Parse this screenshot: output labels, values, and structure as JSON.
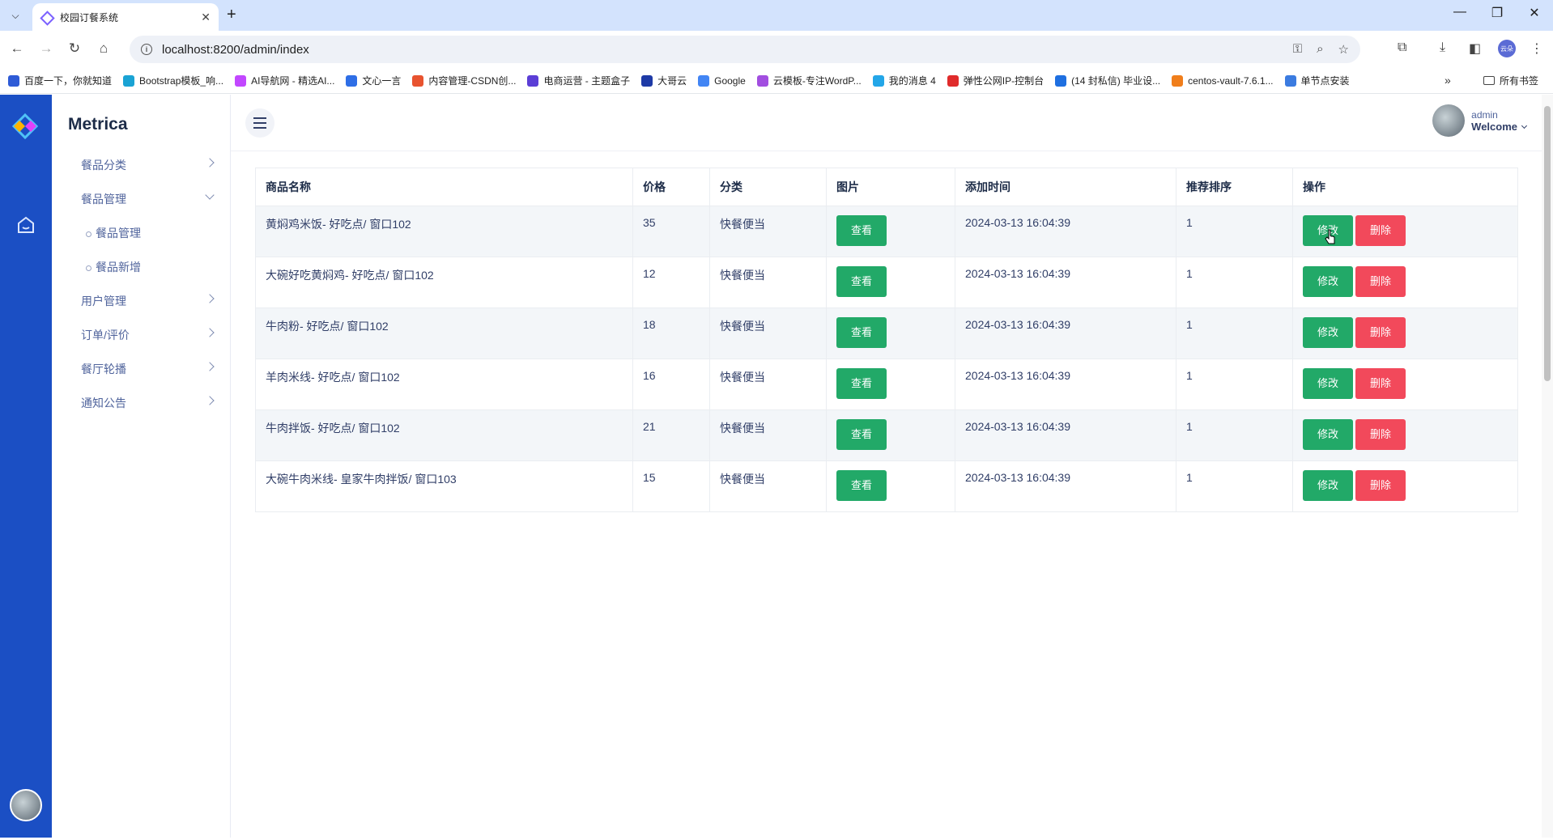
{
  "browser": {
    "tab_title": "校园订餐系统",
    "url": "localhost:8200/admin/index",
    "bookmarks": [
      {
        "label": "百度一下，你就知道",
        "color": "#2e5bd6"
      },
      {
        "label": "Bootstrap模板_响...",
        "color": "#1aa3d4"
      },
      {
        "label": "AI导航网 - 精选AI...",
        "color": "#c247ff"
      },
      {
        "label": "文心一言",
        "color": "#2e6ee6"
      },
      {
        "label": "内容管理-CSDN创...",
        "color": "#e8532f"
      },
      {
        "label": "电商运营 - 主题盒子",
        "color": "#5b3ed6"
      },
      {
        "label": "大哥云",
        "color": "#1e3aa6"
      },
      {
        "label": "Google",
        "color": "#4285f4"
      },
      {
        "label": "云模板-专注WordP...",
        "color": "#a24ee0"
      },
      {
        "label": "我的消息 4",
        "color": "#23a6e8"
      },
      {
        "label": "弹性公网IP-控制台",
        "color": "#e02b2b"
      },
      {
        "label": "(14 封私信) 毕业设...",
        "color": "#1e6fe0"
      },
      {
        "label": "centos-vault-7.6.1...",
        "color": "#f07e1b"
      },
      {
        "label": "单节点安装",
        "color": "#3b7be0"
      }
    ],
    "bookmarks_folder": "所有书签",
    "profile_initials": "云朵"
  },
  "sidebar": {
    "brand": "Metrica",
    "menu": [
      {
        "label": "餐品分类",
        "expanded": false
      },
      {
        "label": "餐品管理",
        "expanded": true,
        "children": [
          "餐品管理",
          "餐品新增"
        ]
      },
      {
        "label": "用户管理",
        "expanded": false
      },
      {
        "label": "订单/评价",
        "expanded": false
      },
      {
        "label": "餐厅轮播",
        "expanded": false
      },
      {
        "label": "通知公告",
        "expanded": false
      }
    ]
  },
  "header": {
    "user_name": "admin",
    "welcome": "Welcome"
  },
  "table": {
    "columns": [
      "商品名称",
      "价格",
      "分类",
      "图片",
      "添加时间",
      "推荐排序",
      "操作"
    ],
    "view_label": "查看",
    "edit_label": "修改",
    "delete_label": "删除",
    "rows": [
      {
        "name": "黄焖鸡米饭- 好吃点/ 窗口102",
        "price": "35",
        "category": "快餐便当",
        "time": "2024-03-13 16:04:39",
        "sort": "1"
      },
      {
        "name": "大碗好吃黄焖鸡- 好吃点/ 窗口102",
        "price": "12",
        "category": "快餐便当",
        "time": "2024-03-13 16:04:39",
        "sort": "1"
      },
      {
        "name": "牛肉粉- 好吃点/ 窗口102",
        "price": "18",
        "category": "快餐便当",
        "time": "2024-03-13 16:04:39",
        "sort": "1"
      },
      {
        "name": "羊肉米线- 好吃点/ 窗口102",
        "price": "16",
        "category": "快餐便当",
        "time": "2024-03-13 16:04:39",
        "sort": "1"
      },
      {
        "name": "牛肉拌饭- 好吃点/ 窗口102",
        "price": "21",
        "category": "快餐便当",
        "time": "2024-03-13 16:04:39",
        "sort": "1"
      },
      {
        "name": "大碗牛肉米线- 皇家牛肉拌饭/ 窗口103",
        "price": "15",
        "category": "快餐便当",
        "time": "2024-03-13 16:04:39",
        "sort": "1"
      }
    ]
  }
}
